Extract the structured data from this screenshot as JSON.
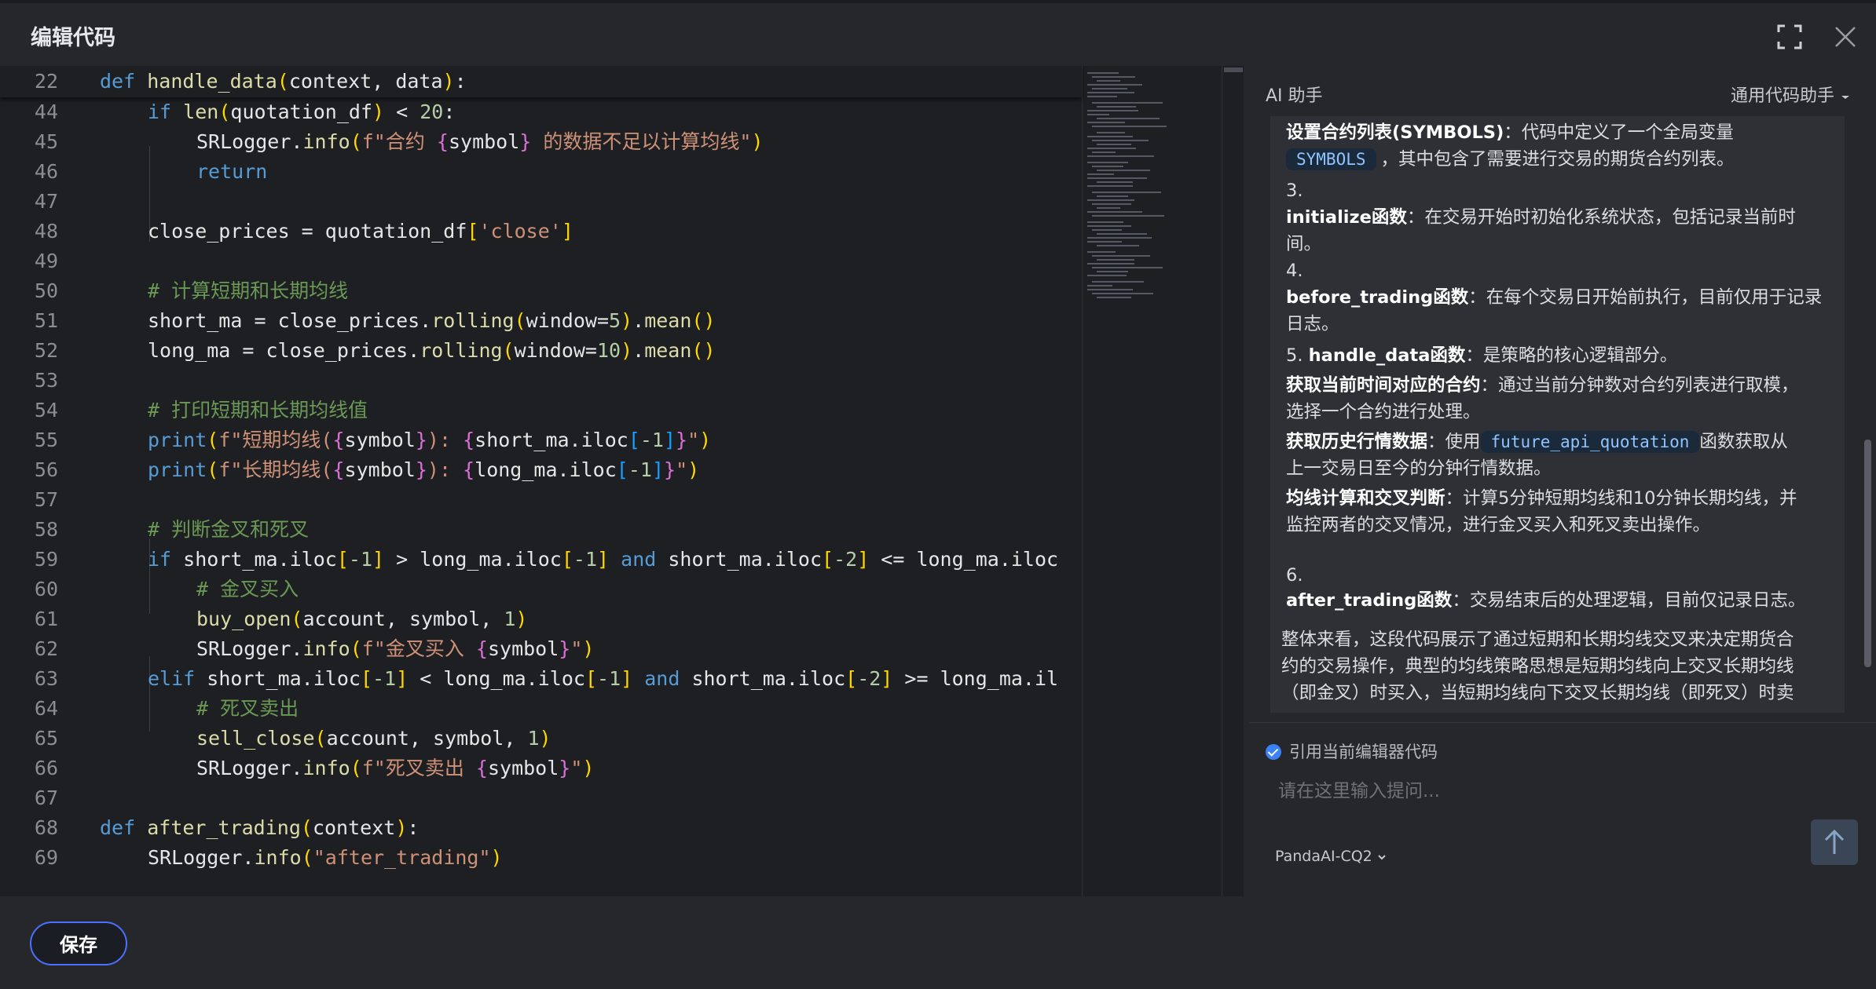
{
  "dialog": {
    "title": "编辑代码"
  },
  "editor": {
    "sticky": {
      "ln": "22",
      "code": "def handle_data(context, data):"
    },
    "lines": [
      {
        "ln": "44",
        "code": "if len(quotation_df) < 20:"
      },
      {
        "ln": "45",
        "code": "SRLogger.info(f\"合约 {symbol} 的数据不足以计算均线\")"
      },
      {
        "ln": "46",
        "code": "return"
      },
      {
        "ln": "47",
        "code": ""
      },
      {
        "ln": "48",
        "code": "close_prices = quotation_df['close']"
      },
      {
        "ln": "49",
        "code": ""
      },
      {
        "ln": "50",
        "code": "# 计算短期和长期均线"
      },
      {
        "ln": "51",
        "code": "short_ma = close_prices.rolling(window=5).mean()"
      },
      {
        "ln": "52",
        "code": "long_ma = close_prices.rolling(window=10).mean()"
      },
      {
        "ln": "53",
        "code": ""
      },
      {
        "ln": "54",
        "code": "# 打印短期和长期均线值"
      },
      {
        "ln": "55",
        "code": "print(f\"短期均线({symbol}): {short_ma.iloc[-1]}\")"
      },
      {
        "ln": "56",
        "code": "print(f\"长期均线({symbol}): {long_ma.iloc[-1]}\")"
      },
      {
        "ln": "57",
        "code": ""
      },
      {
        "ln": "58",
        "code": "# 判断金叉和死叉"
      },
      {
        "ln": "59",
        "code": "if short_ma.iloc[-1] > long_ma.iloc[-1] and short_ma.iloc[-2] <= long_ma.iloc"
      },
      {
        "ln": "60",
        "code": "# 金叉买入"
      },
      {
        "ln": "61",
        "code": "buy_open(account, symbol, 1)"
      },
      {
        "ln": "62",
        "code": "SRLogger.info(f\"金叉买入 {symbol}\")"
      },
      {
        "ln": "63",
        "code": "elif short_ma.iloc[-1] < long_ma.iloc[-1] and short_ma.iloc[-2] >= long_ma.il"
      },
      {
        "ln": "64",
        "code": "# 死叉卖出"
      },
      {
        "ln": "65",
        "code": "sell_close(account, symbol, 1)"
      },
      {
        "ln": "66",
        "code": "SRLogger.info(f\"死叉卖出 {symbol}\")"
      },
      {
        "ln": "67",
        "code": ""
      },
      {
        "ln": "68",
        "code": "def after_trading(context):"
      },
      {
        "ln": "69",
        "code": "SRLogger.info(\"after_trading\")"
      }
    ]
  },
  "ai": {
    "title": "AI 助手",
    "mode": "通用代码助手",
    "messages": {
      "l1_bold": "设置合约列表(SYMBOLS)",
      "l1_text": "：代码中定义了一个全局变量",
      "l2_pill": "SYMBOLS",
      "l2_text": "，其中包含了需要进行交易的期货合约列表。",
      "n3": "3.",
      "l3_bold": "initialize函数",
      "l3_text": "：在交易开始时初始化系统状态，包括记录当前时",
      "l3b": "间。",
      "n4": "4.",
      "l4_bold": "before_trading函数",
      "l4_text": "：在每个交易日开始前执行，目前仅用于记录",
      "l4b": "日志。",
      "l5_num": "5. ",
      "l5_bold": "handle_data函数",
      "l5_text": "：是策略的核心逻辑部分。",
      "l6_bold": "获取当前时间对应的合约",
      "l6_text": "：通过当前分钟数对合约列表进行取模，",
      "l6b": "选择一个合约进行处理。",
      "l7_bold": "获取历史行情数据",
      "l7_text": "：使用",
      "l7_pill": "future_api_quotation",
      "l7_text2": "函数获取从",
      "l7b": "上一交易日至今的分钟行情数据。",
      "l8_bold": "均线计算和交叉判断",
      "l8_text": "：计算5分钟短期均线和10分钟长期均线，并",
      "l8b": "监控两者的交叉情况，进行金叉买入和死叉卖出操作。",
      "n6": "6.",
      "l9_bold": "after_trading函数",
      "l9_text": "：交易结束后的处理逻辑，目前仅记录日志。",
      "s1": "整体来看，这段代码展示了通过短期和长期均线交叉来决定期货合",
      "s2": "约的交易操作，典型的均线策略思想是短期均线向上交叉长期均线",
      "s3": "（即金叉）时买入，当短期均线向下交叉长期均线（即死叉）时卖"
    },
    "reference_label": "引用当前编辑器代码",
    "input_placeholder": "请在这里输入提问...",
    "model": "PandaAI-CQ2"
  },
  "footer": {
    "save_label": "保存"
  },
  "icons": {
    "fullscreen": "fullscreen-icon",
    "close": "close-icon",
    "send": "arrow-up-icon",
    "check": "check-circle-icon",
    "chevron": "chevron-down-icon"
  },
  "colors": {
    "keyword": "#569cd6",
    "function": "#dcdcaa",
    "string": "#ce9178",
    "number": "#b5cea8",
    "comment": "#6a9955",
    "accent": "#4d6fff"
  }
}
